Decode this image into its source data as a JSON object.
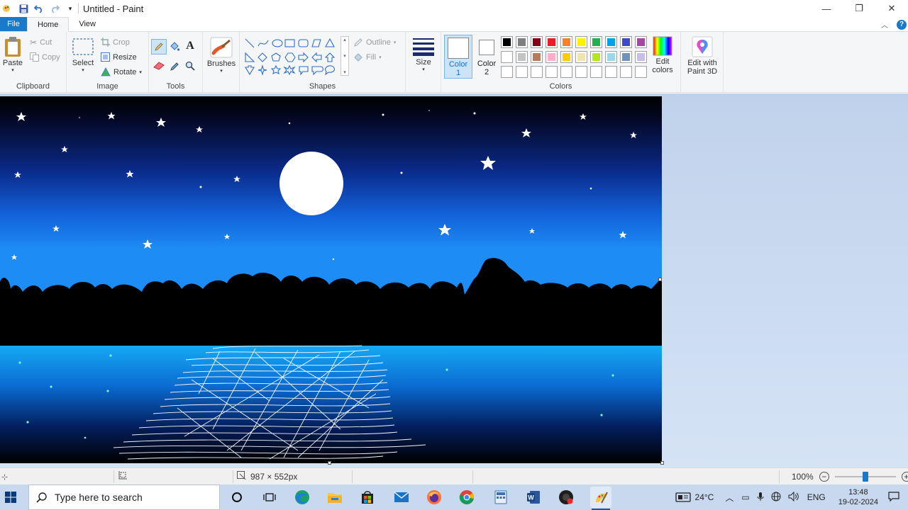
{
  "window": {
    "title": "Untitled - Paint",
    "controls": {
      "minimize": "—",
      "maximize": "❐",
      "close": "✕"
    }
  },
  "tabs": {
    "file": "File",
    "home": "Home",
    "view": "View"
  },
  "ribbon": {
    "clipboard": {
      "label": "Clipboard",
      "paste": "Paste",
      "cut": "Cut",
      "copy": "Copy"
    },
    "image": {
      "label": "Image",
      "select": "Select",
      "crop": "Crop",
      "resize": "Resize",
      "rotate": "Rotate"
    },
    "tools": {
      "label": "Tools"
    },
    "brushes": {
      "label": "Brushes"
    },
    "shapes": {
      "label": "Shapes",
      "outline": "Outline",
      "fill": "Fill"
    },
    "size": {
      "label": "Size"
    },
    "colors": {
      "label": "Colors",
      "color1": "Color 1",
      "color2": "Color 2",
      "edit_colors": "Edit colors",
      "palette_row1": [
        "#000000",
        "#7f7f7f",
        "#880015",
        "#ed1c24",
        "#ff7f27",
        "#fff200",
        "#22b14c",
        "#00a2e8",
        "#3f48cc",
        "#a349a4"
      ],
      "palette_row2": [
        "#ffffff",
        "#c3c3c3",
        "#b97a57",
        "#ffaec9",
        "#ffc90e",
        "#efe4b0",
        "#b5e61d",
        "#99d9ea",
        "#7092be",
        "#c8bfe7"
      ]
    },
    "paint3d": {
      "label": "Edit with Paint 3D"
    }
  },
  "statusbar": {
    "dimensions": "987 × 552px",
    "zoom": "100%"
  },
  "taskbar": {
    "search_placeholder": "Type here to search",
    "weather": "24°C",
    "language": "ENG",
    "time": "13:48",
    "date": "19-02-2024"
  }
}
